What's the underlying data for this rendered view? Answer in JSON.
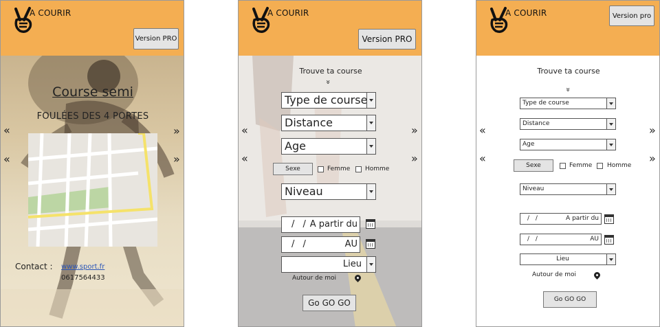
{
  "brand": "A COURIR",
  "screen1": {
    "version_btn": "Version PRO",
    "arrow_left": "«",
    "arrow_right": "»",
    "title": "Course semi",
    "subtitle": "FOULÉES DES 4 PORTES",
    "contact_label": "Contact :",
    "contact_link": "www.sport.fr",
    "contact_phone": "0617564433"
  },
  "screen2": {
    "version_btn": "Version PRO",
    "title": "Trouve ta course",
    "chevron": "»",
    "type_course": "Type de course",
    "distance": "Distance",
    "age": "Age",
    "sexe_btn": "Sexe",
    "femme": "Femme",
    "homme": "Homme",
    "niveau": "Niveau",
    "date_from_slashes": "/ /",
    "date_from_label": "A partir du",
    "date_to_slashes": "/ /",
    "date_to_label": "AU",
    "lieu": "Lieu",
    "autour": "Autour de moi",
    "go": "Go GO GO"
  },
  "screen3": {
    "version_btn": "Version pro",
    "title": "Trouve ta course",
    "chevron": "»",
    "type_course": "Type de course",
    "distance": "Distance",
    "age": "Age",
    "sexe_btn": "Sexe",
    "femme": "Femme",
    "homme": "Homme",
    "niveau": "Niveau",
    "date_from_slashes": "/ /",
    "date_from_label": "A partir du",
    "date_to_slashes": "/ /",
    "date_to_label": "AU",
    "lieu": "Lieu",
    "autour": "Autour de moi",
    "go": "Go GO GO"
  },
  "colors": {
    "header": "#f4ae52",
    "link": "#2a55b8",
    "map_road_major": "#f5e26a",
    "map_park": "#bcd6a4"
  },
  "icons": [
    "victory-hand-logo-icon",
    "calendar-icon",
    "map-pin-icon",
    "double-chevron-icon"
  ]
}
